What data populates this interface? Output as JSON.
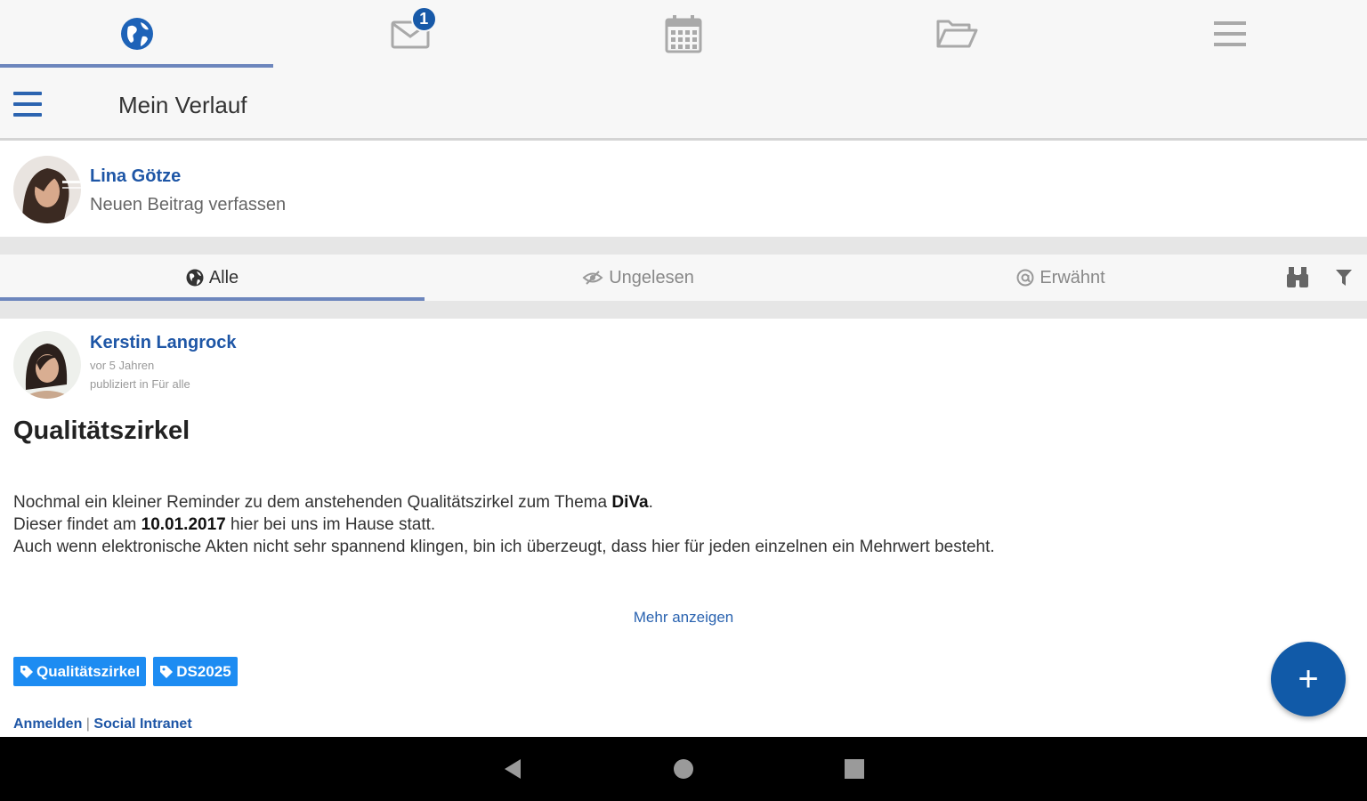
{
  "topnav": {
    "tabs": [
      {
        "icon": "globe-icon",
        "active": true
      },
      {
        "icon": "mail-icon",
        "badge": "1"
      },
      {
        "icon": "calendar-icon"
      },
      {
        "icon": "folder-open-icon"
      },
      {
        "icon": "menu-icon"
      }
    ]
  },
  "header": {
    "title": "Mein Verlauf"
  },
  "composer": {
    "user_name": "Lina Götze",
    "prompt": "Neuen Beitrag verfassen"
  },
  "filters": {
    "tabs": [
      {
        "label": "Alle",
        "icon": "globe-icon",
        "active": true
      },
      {
        "label": "Ungelesen",
        "icon": "eye-slash-icon"
      },
      {
        "label": "Erwähnt",
        "icon": "at-icon"
      }
    ],
    "actions": [
      {
        "icon": "binoculars-icon"
      },
      {
        "icon": "filter-icon"
      }
    ]
  },
  "post": {
    "author": "Kerstin Langrock",
    "time": "vor 5 Jahren",
    "published_in": "publiziert in Für alle",
    "title": "Qualitätszirkel",
    "body": {
      "line1_pre": "Nochmal ein kleiner Reminder zu dem anstehenden Qualitätszirkel zum Thema ",
      "line1_bold": "DiVa",
      "line1_post": ".",
      "line2_pre": "Dieser findet am ",
      "line2_bold": "10.01.2017",
      "line2_post": " hier bei uns im Hause statt.",
      "line3": "Auch wenn elektronische Akten nicht sehr spannend klingen, bin ich überzeugt, dass hier für jeden einzelnen ein Mehrwert besteht."
    },
    "more_label": "Mehr anzeigen",
    "tags": [
      "Qualitätszirkel",
      "DS2025"
    ],
    "footer": {
      "link1": "Anmelden",
      "separator": "|",
      "link2": "Social Intranet"
    }
  },
  "fab": {
    "label": "+"
  },
  "colors": {
    "brand": "#1e56a6",
    "accent": "#115aa8",
    "tag": "#1d8cf2",
    "tab_indicator": "#6d86bd"
  }
}
